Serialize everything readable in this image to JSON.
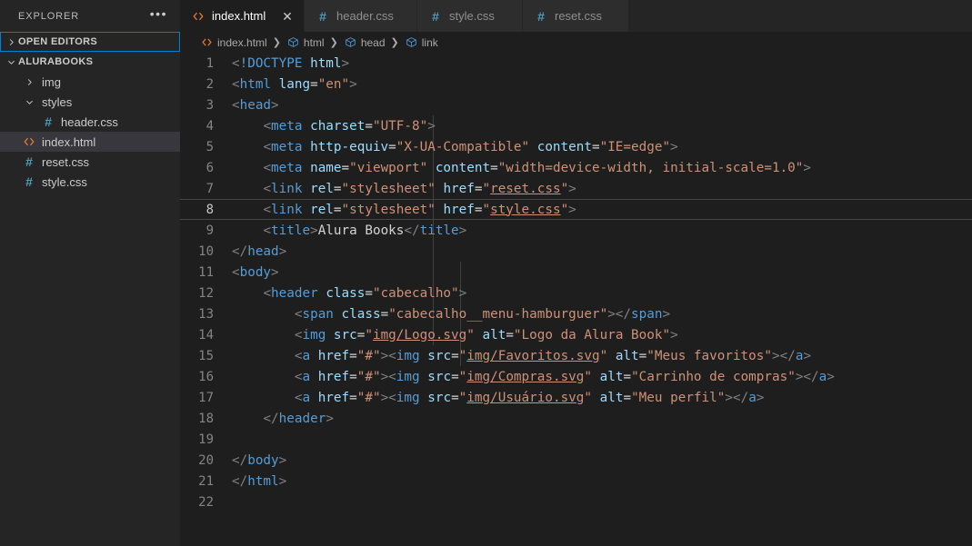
{
  "sidebar": {
    "title": "EXPLORER",
    "more_actions_label": "•••",
    "sections": [
      {
        "label": "OPEN EDITORS",
        "expanded": false,
        "focused": true
      },
      {
        "label": "ALURABOOKS",
        "expanded": true,
        "focused": false
      }
    ],
    "tree": [
      {
        "label": "img",
        "type": "folder",
        "expanded": false,
        "icon": "chevron-right-icon",
        "depth": 1,
        "selected": false
      },
      {
        "label": "styles",
        "type": "folder",
        "expanded": true,
        "icon": "chevron-down-icon",
        "depth": 1,
        "selected": false
      },
      {
        "label": "header.css",
        "type": "file",
        "icon": "css-hash-icon",
        "depth": 2,
        "selected": false
      },
      {
        "label": "index.html",
        "type": "file",
        "icon": "html-tag-icon",
        "depth": 1,
        "selected": true
      },
      {
        "label": "reset.css",
        "type": "file",
        "icon": "css-hash-icon",
        "depth": 1,
        "selected": false
      },
      {
        "label": "style.css",
        "type": "file",
        "icon": "css-hash-icon",
        "depth": 1,
        "selected": false
      }
    ]
  },
  "tabs": [
    {
      "label": "index.html",
      "icon": "html-tag-icon",
      "active": true,
      "close_label": "✕"
    },
    {
      "label": "header.css",
      "icon": "css-hash-icon",
      "active": false,
      "close_label": ""
    },
    {
      "label": "style.css",
      "icon": "css-hash-icon",
      "active": false,
      "close_label": ""
    },
    {
      "label": "reset.css",
      "icon": "css-hash-icon",
      "active": false,
      "close_label": ""
    }
  ],
  "breadcrumbs": [
    {
      "label": "index.html",
      "icon": "html-tag-icon"
    },
    {
      "label": "html",
      "icon": "symbol-field-icon"
    },
    {
      "label": "head",
      "icon": "symbol-field-icon"
    },
    {
      "label": "link",
      "icon": "symbol-field-icon"
    }
  ],
  "breadcrumb_separator": "❯",
  "editor": {
    "current_line": 8,
    "total_lines": 22,
    "lines": [
      {
        "n": 1,
        "indent": 0
      },
      {
        "n": 2,
        "indent": 0
      },
      {
        "n": 3,
        "indent": 0
      },
      {
        "n": 4,
        "indent": 1
      },
      {
        "n": 5,
        "indent": 1
      },
      {
        "n": 6,
        "indent": 1
      },
      {
        "n": 7,
        "indent": 1
      },
      {
        "n": 8,
        "indent": 1
      },
      {
        "n": 9,
        "indent": 1
      },
      {
        "n": 10,
        "indent": 0
      },
      {
        "n": 11,
        "indent": 0
      },
      {
        "n": 12,
        "indent": 1
      },
      {
        "n": 13,
        "indent": 2
      },
      {
        "n": 14,
        "indent": 2
      },
      {
        "n": 15,
        "indent": 2
      },
      {
        "n": 16,
        "indent": 2
      },
      {
        "n": 17,
        "indent": 2
      },
      {
        "n": 18,
        "indent": 1
      },
      {
        "n": 19,
        "indent": 1
      },
      {
        "n": 20,
        "indent": 0
      },
      {
        "n": 21,
        "indent": 0
      },
      {
        "n": 22,
        "indent": 0
      }
    ],
    "code": [
      "<!DOCTYPE html>",
      "<html lang=\"en\">",
      "<head>",
      "    <meta charset=\"UTF-8\">",
      "    <meta http-equiv=\"X-UA-Compatible\" content=\"IE=edge\">",
      "    <meta name=\"viewport\" content=\"width=device-width, initial-scale=1.0\">",
      "    <link rel=\"stylesheet\" href=\"reset.css\">",
      "    <link rel=\"stylesheet\" href=\"style.css\">",
      "    <title>Alura Books</title>",
      "</head>",
      "<body>",
      "    <header class=\"cabecalho\">",
      "        <span class=\"cabecalho__menu-hamburguer\"></span>",
      "        <img src=\"img/Logo.svg\" alt=\"Logo da Alura Book\">",
      "        <a href=\"#\"><img src=\"img/Favoritos.svg\" alt=\"Meus favoritos\"></a>",
      "        <a href=\"#\"><img src=\"img/Compras.svg\" alt=\"Carrinho de compras\"></a>",
      "        <a href=\"#\"><img src=\"img/Usuário.svg\" alt=\"Meu perfil\"></a>",
      "    </header>",
      "",
      "</body>",
      "</html>",
      ""
    ]
  },
  "colors": {
    "editor_bg": "#1e1e1e",
    "sidebar_bg": "#252526",
    "tab_inactive_bg": "#2d2d2d",
    "selection_bg": "#37373d",
    "focus_border": "#007fd4",
    "html_icon": "#e37933",
    "css_icon": "#519aba",
    "tag_blue": "#569cd6",
    "attr_blue": "#9cdcfe",
    "string_orange": "#ce9178",
    "line_number": "#858585",
    "text_default": "#d4d4d4"
  }
}
